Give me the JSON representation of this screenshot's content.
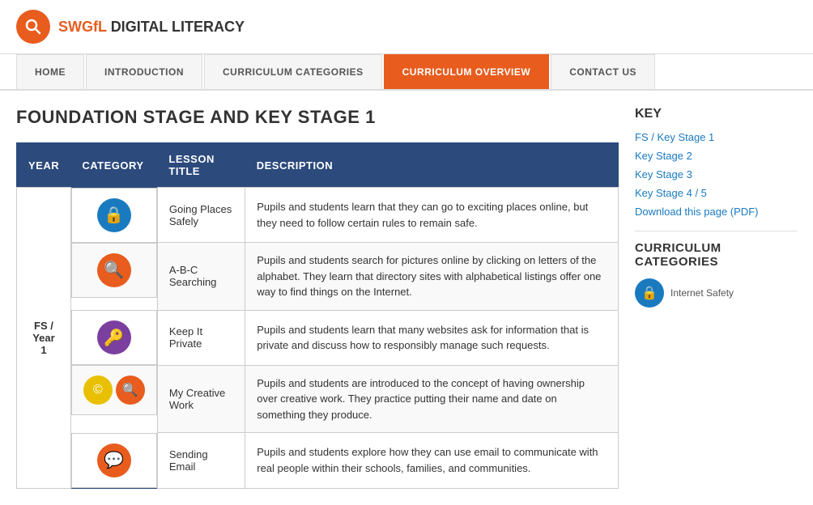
{
  "header": {
    "logo_brand": "SWGfL",
    "logo_bold": "DIGITAL LITERACY"
  },
  "nav": {
    "items": [
      {
        "id": "home",
        "label": "HOME",
        "active": false
      },
      {
        "id": "introduction",
        "label": "INTRODUCTION",
        "active": false
      },
      {
        "id": "curriculum-categories",
        "label": "CURRICULUM CATEGORIES",
        "active": false
      },
      {
        "id": "curriculum-overview",
        "label": "CURRICULUM OVERVIEW",
        "active": true
      },
      {
        "id": "contact-us",
        "label": "CONTACT US",
        "active": false
      }
    ]
  },
  "main": {
    "page_title": "FOUNDATION STAGE AND KEY STAGE 1",
    "table": {
      "headers": [
        "YEAR",
        "CATEGORY",
        "LESSON TITLE",
        "DESCRIPTION"
      ],
      "rows": [
        {
          "year": "FS / Year 1",
          "year_rowspan": 5,
          "lesson_title": "Going Places Safely",
          "icon_type": "lock-blue",
          "description": "Pupils and students learn that they can go to exciting places online, but they need to follow certain rules to remain safe."
        },
        {
          "year": "",
          "lesson_title": "A-B-C Searching",
          "icon_type": "search-red",
          "description": "Pupils and students search for pictures online by clicking on letters of the alphabet. They learn that directory sites with alphabetical listings offer one way to find things on the Internet."
        },
        {
          "year": "",
          "lesson_title": "Keep It Private",
          "icon_type": "key-purple",
          "description": "Pupils and students learn that many websites ask for information that is private and discuss how to responsibly manage such requests."
        },
        {
          "year": "",
          "lesson_title": "My Creative Work",
          "icon_type": "creative-multi",
          "description": "Pupils and students are introduced to the concept of having ownership over creative work. They practice putting their name and date on something they produce."
        },
        {
          "year": "",
          "lesson_title": "Sending Email",
          "icon_type": "email-orange",
          "description": "Pupils and students explore how they can use email to communicate with real people within their schools, families, and communities."
        }
      ]
    }
  },
  "sidebar": {
    "key_title": "KEY",
    "key_links": [
      {
        "label": "FS / Key Stage 1",
        "color": "#1a7abf"
      },
      {
        "label": "Key Stage 2",
        "color": "#1a7abf"
      },
      {
        "label": "Key Stage 3",
        "color": "#1a7abf"
      },
      {
        "label": "Key Stage 4 / 5",
        "color": "#1a7abf"
      },
      {
        "label": "Download this page (PDF)",
        "color": "#1a7abf"
      }
    ],
    "categories_title": "CURRICULUM CATEGORIES",
    "categories": [
      {
        "label": "Internet Safety",
        "icon_type": "lock-blue"
      }
    ]
  }
}
